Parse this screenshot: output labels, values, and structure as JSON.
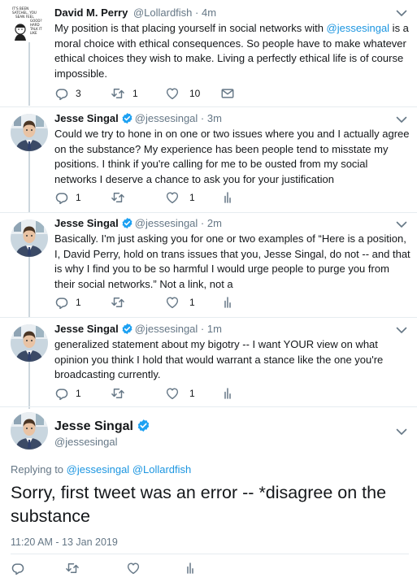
{
  "colors": {
    "link": "#1b95e0",
    "secondary": "#657786",
    "divider": "#e6ecf0",
    "verified": "#1da1f2"
  },
  "tweets": [
    {
      "name": "David M. Perry",
      "handle": "@Lollardfish",
      "dot": "·",
      "time": "4m",
      "verified": false,
      "body_pre": "My position is that placing yourself in social networks with ",
      "body_mention": "@jessesingal",
      "body_post": " is a moral choice with ethical consequences.  So people have to make whatever ethical choices they wish to make. Living a perfectly ethical life is of course impossible.",
      "reply_count": "3",
      "retweet_count": "1",
      "like_count": "10",
      "avatar_icon": "comic-drawing-avatar",
      "avatar_text": "IT'S BEEN SATCHEL. YOU SEAN FEEL GOOD? HARD TALK IT LIKE"
    },
    {
      "name": "Jesse Singal",
      "handle": "@jessesingal",
      "dot": "·",
      "time": "3m",
      "verified": true,
      "body": "Could we try to hone in on one or two issues where you and I actually agree on the substance? My experience has been people tend to misstate my positions. I think if you're calling for me to be ousted from my social networks I deserve a chance to ask you for your justification",
      "reply_count": "1",
      "retweet_count": "",
      "like_count": "1"
    },
    {
      "name": "Jesse Singal",
      "handle": "@jessesingal",
      "dot": "·",
      "time": "2m",
      "verified": true,
      "body": "Basically. I'm just asking you for one or two examples of “Here is a position, I, David Perry, hold on trans issues that you, Jesse Singal, do not -- and that is why I find you to be so harmful I would urge people to purge you from their social networks.” Not a link, not a",
      "reply_count": "1",
      "retweet_count": "",
      "like_count": "1"
    },
    {
      "name": "Jesse Singal",
      "handle": "@jessesingal",
      "dot": "·",
      "time": "1m",
      "verified": true,
      "body": "generalized statement about my bigotry -- I want YOUR view on what opinion you think I hold that would warrant a stance like the one you're broadcasting currently.",
      "reply_count": "1",
      "retweet_count": "",
      "like_count": "1"
    }
  ],
  "main_tweet": {
    "name": "Jesse Singal",
    "handle": "@jessesingal",
    "replying_label": "Replying to",
    "replying_to_1": "@jessesingal",
    "replying_to_2": "@Lollardfish",
    "text": "Sorry, first tweet was an error -- *disagree on the substance",
    "timestamp": "11:20 AM - 13 Jan 2019"
  },
  "icons": {
    "reply": "reply-icon",
    "retweet": "retweet-icon",
    "like": "heart-icon",
    "analytics": "analytics-icon",
    "caret": "chevron-down-icon",
    "verified": "verified-badge-icon"
  }
}
